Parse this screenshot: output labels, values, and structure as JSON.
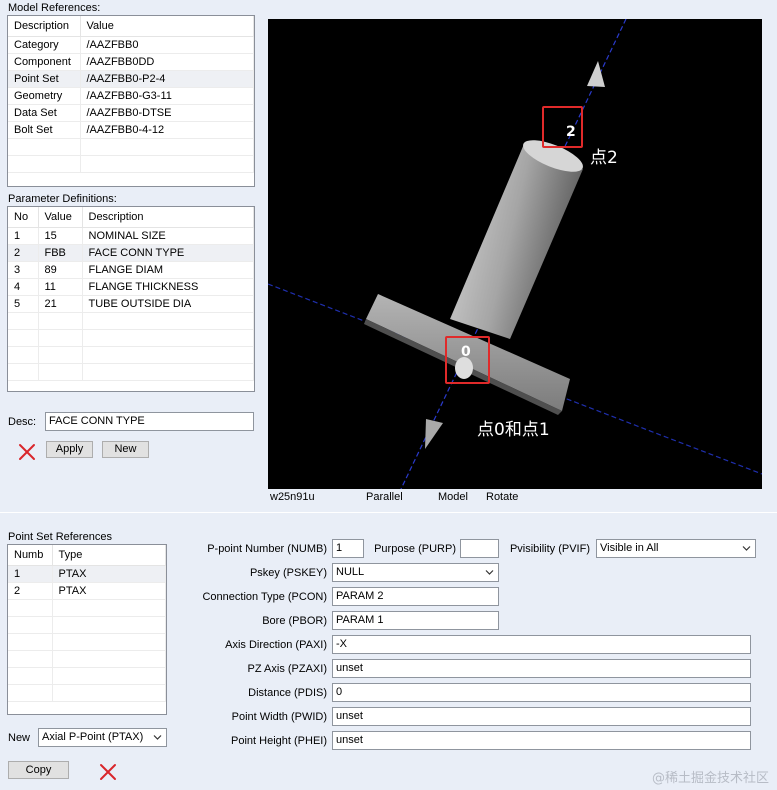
{
  "model_refs": {
    "title": "Model References:",
    "headers": [
      "Description",
      "Value"
    ],
    "rows": [
      [
        "Category",
        "/AAZFBB0"
      ],
      [
        "Component",
        "/AAZFBB0DD"
      ],
      [
        "Point Set",
        "/AAZFBB0-P2-4"
      ],
      [
        "Geometry",
        "/AAZFBB0-G3-11"
      ],
      [
        "Data Set",
        "/AAZFBB0-DTSE"
      ],
      [
        "Bolt Set",
        "/AAZFBB0-4-12"
      ]
    ],
    "selected_row": 2
  },
  "param_defs": {
    "title": "Parameter Definitions:",
    "headers": [
      "No",
      "Value",
      "Description"
    ],
    "rows": [
      [
        "1",
        "15",
        "NOMINAL SIZE"
      ],
      [
        "2",
        "FBB",
        "FACE CONN TYPE"
      ],
      [
        "3",
        "89",
        "FLANGE DIAM"
      ],
      [
        "4",
        "11",
        "FLANGE THICKNESS"
      ],
      [
        "5",
        "21",
        "TUBE OUTSIDE DIA"
      ]
    ],
    "selected_row": 1
  },
  "desc": {
    "label": "Desc:",
    "value": "FACE CONN TYPE"
  },
  "buttons": {
    "apply": "Apply",
    "new": "New",
    "copy": "Copy"
  },
  "viewport": {
    "status": [
      "w25n91u",
      "Parallel",
      "Model",
      "Rotate"
    ],
    "marker_top": "2",
    "marker_bottom": "0",
    "annotation_top": "点2",
    "annotation_bottom": "点0和点1"
  },
  "point_set": {
    "title": "Point Set References",
    "headers": [
      "Numb",
      "Type"
    ],
    "rows": [
      [
        "1",
        "PTAX"
      ],
      [
        "2",
        "PTAX"
      ]
    ],
    "selected_row": 0,
    "new_label": "New",
    "new_type": "Axial P-Point (PTAX)"
  },
  "form": {
    "pnumber_label": "P-point Number (NUMB)",
    "pnumber_value": "1",
    "purpose_label": "Purpose (PURP)",
    "purpose_value": "",
    "pvis_label": "Pvisibility (PVIF)",
    "pvis_value": "Visible in All",
    "pskey_label": "Pskey (PSKEY)",
    "pskey_value": "NULL",
    "pcon_label": "Connection Type (PCON)",
    "pcon_value": "PARAM 2",
    "pbor_label": "Bore (PBOR)",
    "pbor_value": "PARAM 1",
    "paxi_label": "Axis Direction (PAXI)",
    "paxi_value": "-X",
    "pzaxi_label": "PZ Axis (PZAXI)",
    "pzaxi_value": "unset",
    "pdis_label": "Distance (PDIS)",
    "pdis_value": "0",
    "pwid_label": "Point Width (PWID)",
    "pwid_value": "unset",
    "phei_label": "Point Height (PHEI)",
    "phei_value": "unset"
  },
  "watermark": "@稀土掘金技术社区",
  "colors": {
    "highlight_box": "#e02a2a",
    "axis_line": "#1f2fae",
    "delete_x": "#d9262b"
  }
}
